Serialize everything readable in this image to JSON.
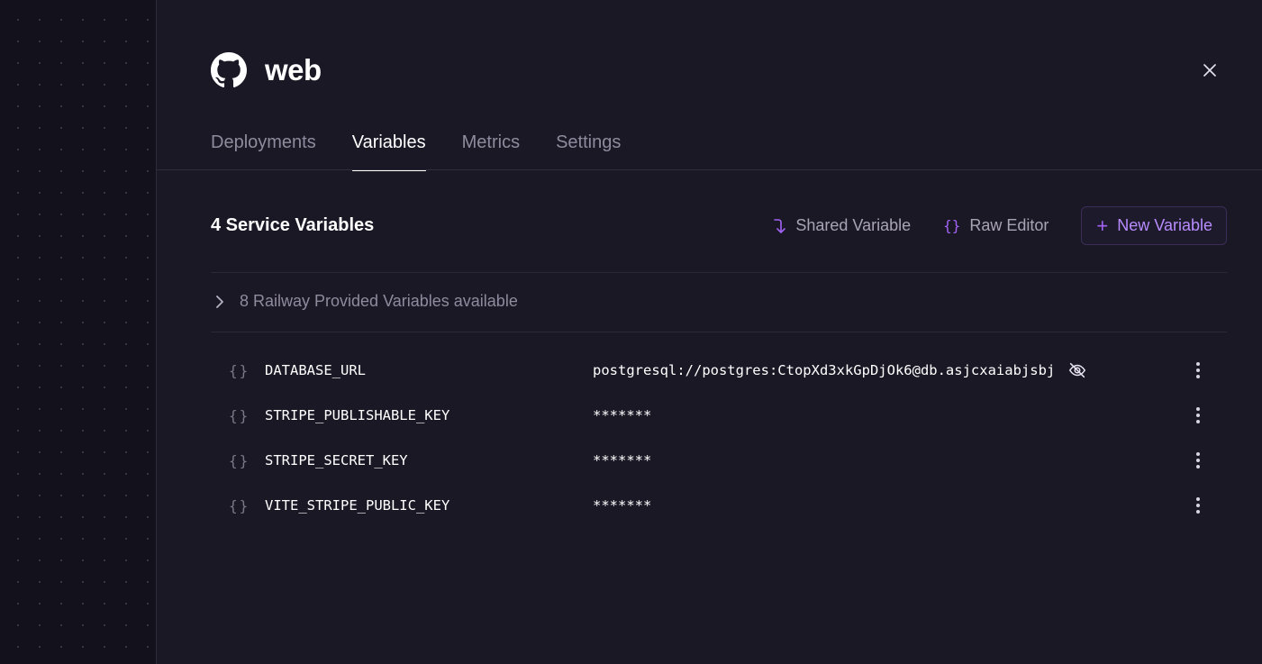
{
  "service": {
    "name": "web",
    "icon": "github-icon"
  },
  "tabs": [
    {
      "label": "Deployments",
      "active": false
    },
    {
      "label": "Variables",
      "active": true
    },
    {
      "label": "Metrics",
      "active": false
    },
    {
      "label": "Settings",
      "active": false
    }
  ],
  "variables_section": {
    "title": "4 Service Variables",
    "actions": {
      "shared_variable": "Shared Variable",
      "raw_editor": "Raw Editor",
      "new_variable": "New Variable"
    },
    "provided": "8 Railway Provided Variables available"
  },
  "variables": [
    {
      "key": "DATABASE_URL",
      "value": "postgresql://postgres:CtopXd3xkGpDjOk6@db.asjcxaiabjsbj",
      "revealed": true
    },
    {
      "key": "STRIPE_PUBLISHABLE_KEY",
      "value": "*******",
      "revealed": false
    },
    {
      "key": "STRIPE_SECRET_KEY",
      "value": "*******",
      "revealed": false
    },
    {
      "key": "VITE_STRIPE_PUBLIC_KEY",
      "value": "*******",
      "revealed": false
    }
  ],
  "colors": {
    "accent": "#a263f5",
    "panel": "#1a1825",
    "background": "#13111c"
  }
}
